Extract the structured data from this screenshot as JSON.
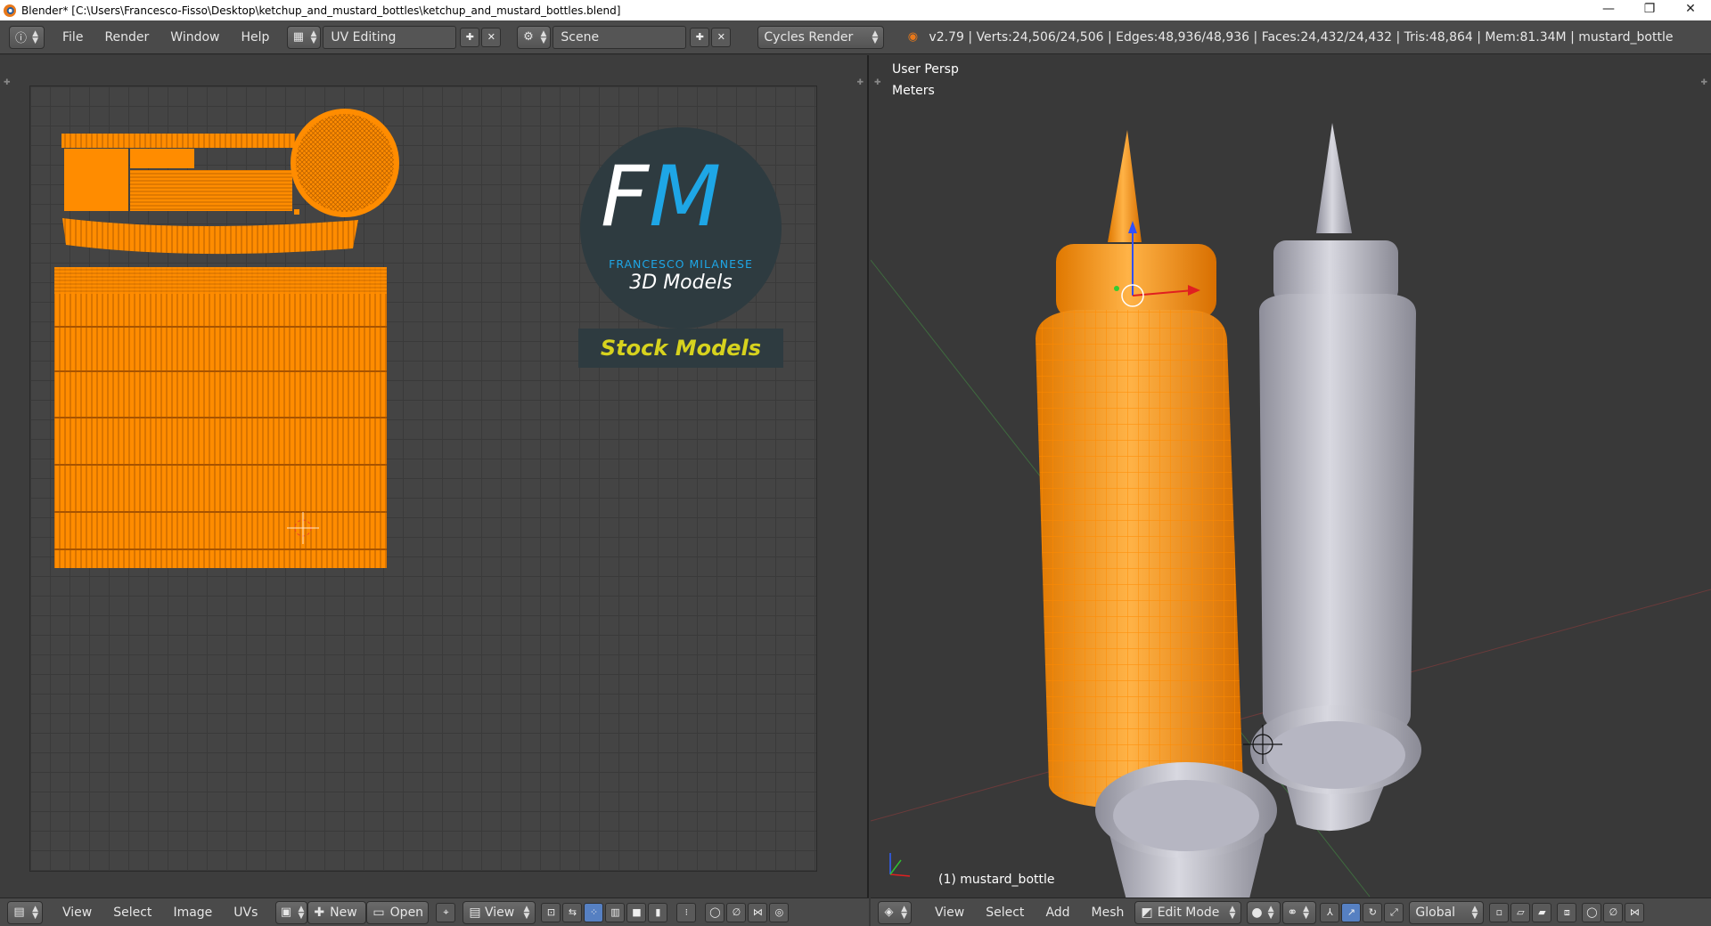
{
  "window": {
    "title": "Blender* [C:\\Users\\Francesco-Fisso\\Desktop\\ketchup_and_mustard_bottles\\ketchup_and_mustard_bottles.blend]",
    "minimize": "—",
    "restore": "❐",
    "close": "✕"
  },
  "header": {
    "menus": [
      "File",
      "Render",
      "Window",
      "Help"
    ],
    "layout": "UV Editing",
    "scene": "Scene",
    "engine": "Cycles Render",
    "stats": "v2.79 | Verts:24,506/24,506 | Edges:48,936/48,936 | Faces:24,432/24,432 | Tris:48,864 | Mem:81.34M | mustard_bottle"
  },
  "uv_editor": {
    "logo_letters_f": "F",
    "logo_letters_m": "M",
    "logo_name": "FRANCESCO MILANESE",
    "logo_sub": "3D Models",
    "logo_banner": "Stock Models",
    "menus": [
      "View",
      "Select",
      "Image",
      "UVs"
    ],
    "new_label": "New",
    "open_label": "Open",
    "view_label": "View"
  },
  "viewport": {
    "perspective": "User Persp",
    "units": "Meters",
    "object_label": "(1) mustard_bottle",
    "menus": [
      "View",
      "Select",
      "Add",
      "Mesh"
    ],
    "mode": "Edit Mode",
    "orientation": "Global"
  },
  "colors": {
    "accent": "#ff8c00",
    "header_bg": "#4a4a4a",
    "panel_bg": "#393939",
    "logo_blue": "#1ea6e6",
    "logo_yellow": "#d7d21e"
  }
}
